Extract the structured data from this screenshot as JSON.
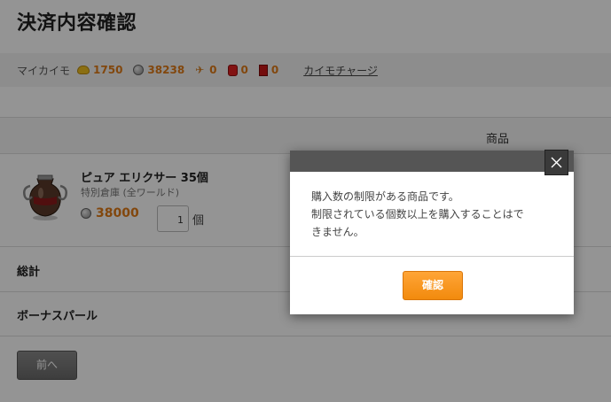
{
  "page": {
    "title": "決済内容確認"
  },
  "balance": {
    "label": "マイカイモ",
    "items": [
      {
        "icon": "gold-coin-icon",
        "value": "1750"
      },
      {
        "icon": "silver-coin-icon",
        "value": "38238"
      },
      {
        "icon": "bird-icon",
        "value": "0"
      },
      {
        "icon": "red-gem-icon",
        "value": "0"
      },
      {
        "icon": "red-card-icon",
        "value": "0"
      }
    ],
    "charge_link": "カイモチャージ",
    "value_color": "#e07a17"
  },
  "table": {
    "column_product": "商品"
  },
  "item": {
    "name": "ピュア エリクサー 35個",
    "sub": "特別倉庫 (全ワールド)",
    "price": "38000",
    "quantity": "1",
    "quantity_unit": "個"
  },
  "summary": {
    "total_label": "総計",
    "bonus_label": "ボーナスパール"
  },
  "nav": {
    "prev_label": "前へ"
  },
  "modal": {
    "line1": "購入数の制限がある商品です。",
    "line2": "制限されている個数以上を購入することはで",
    "line3": "きません。",
    "confirm_label": "確認",
    "accent_color": "#f5921e"
  }
}
